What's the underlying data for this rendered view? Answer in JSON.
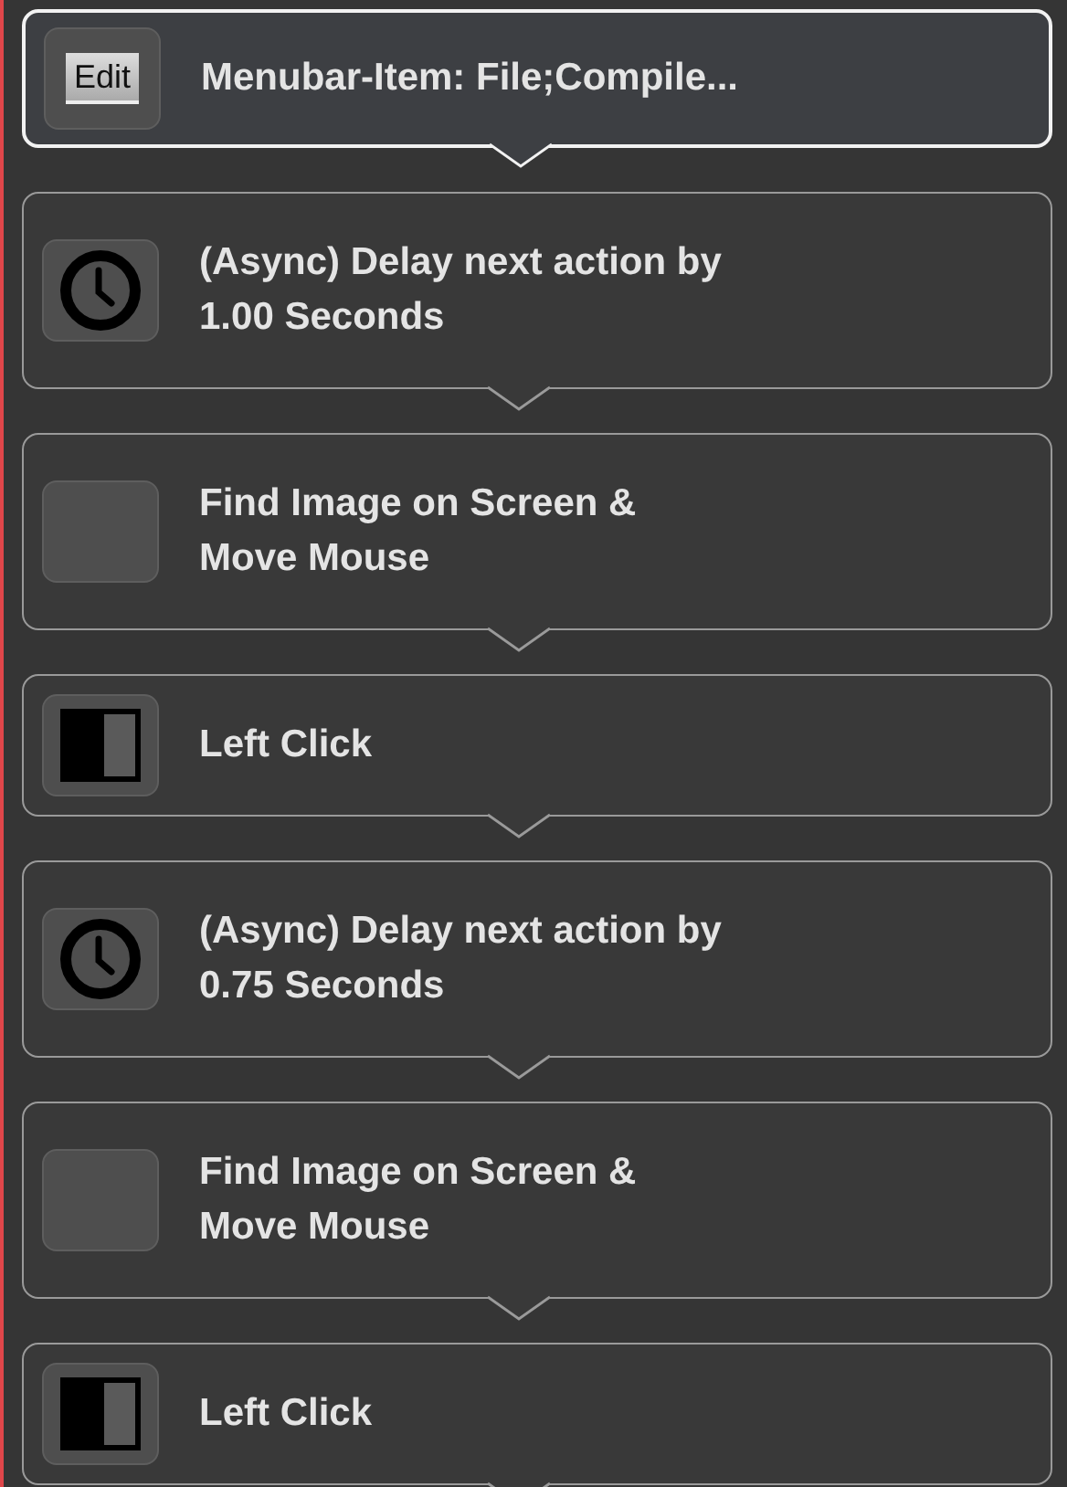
{
  "actions": [
    {
      "kind": "menubar",
      "icon_text": "Edit",
      "label": "Menubar-Item: File;Compile...",
      "selected": true
    },
    {
      "kind": "delay",
      "label": "(Async) Delay next action by\n1.00 Seconds",
      "selected": false
    },
    {
      "kind": "image",
      "label": "Find Image on Screen &\nMove Mouse",
      "selected": false
    },
    {
      "kind": "click",
      "label": "Left Click",
      "selected": false
    },
    {
      "kind": "delay",
      "label": "(Async) Delay next action by\n0.75 Seconds",
      "selected": false
    },
    {
      "kind": "image",
      "label": "Find Image on Screen &\nMove Mouse",
      "selected": false
    },
    {
      "kind": "click",
      "label": "Left Click",
      "selected": false
    }
  ]
}
